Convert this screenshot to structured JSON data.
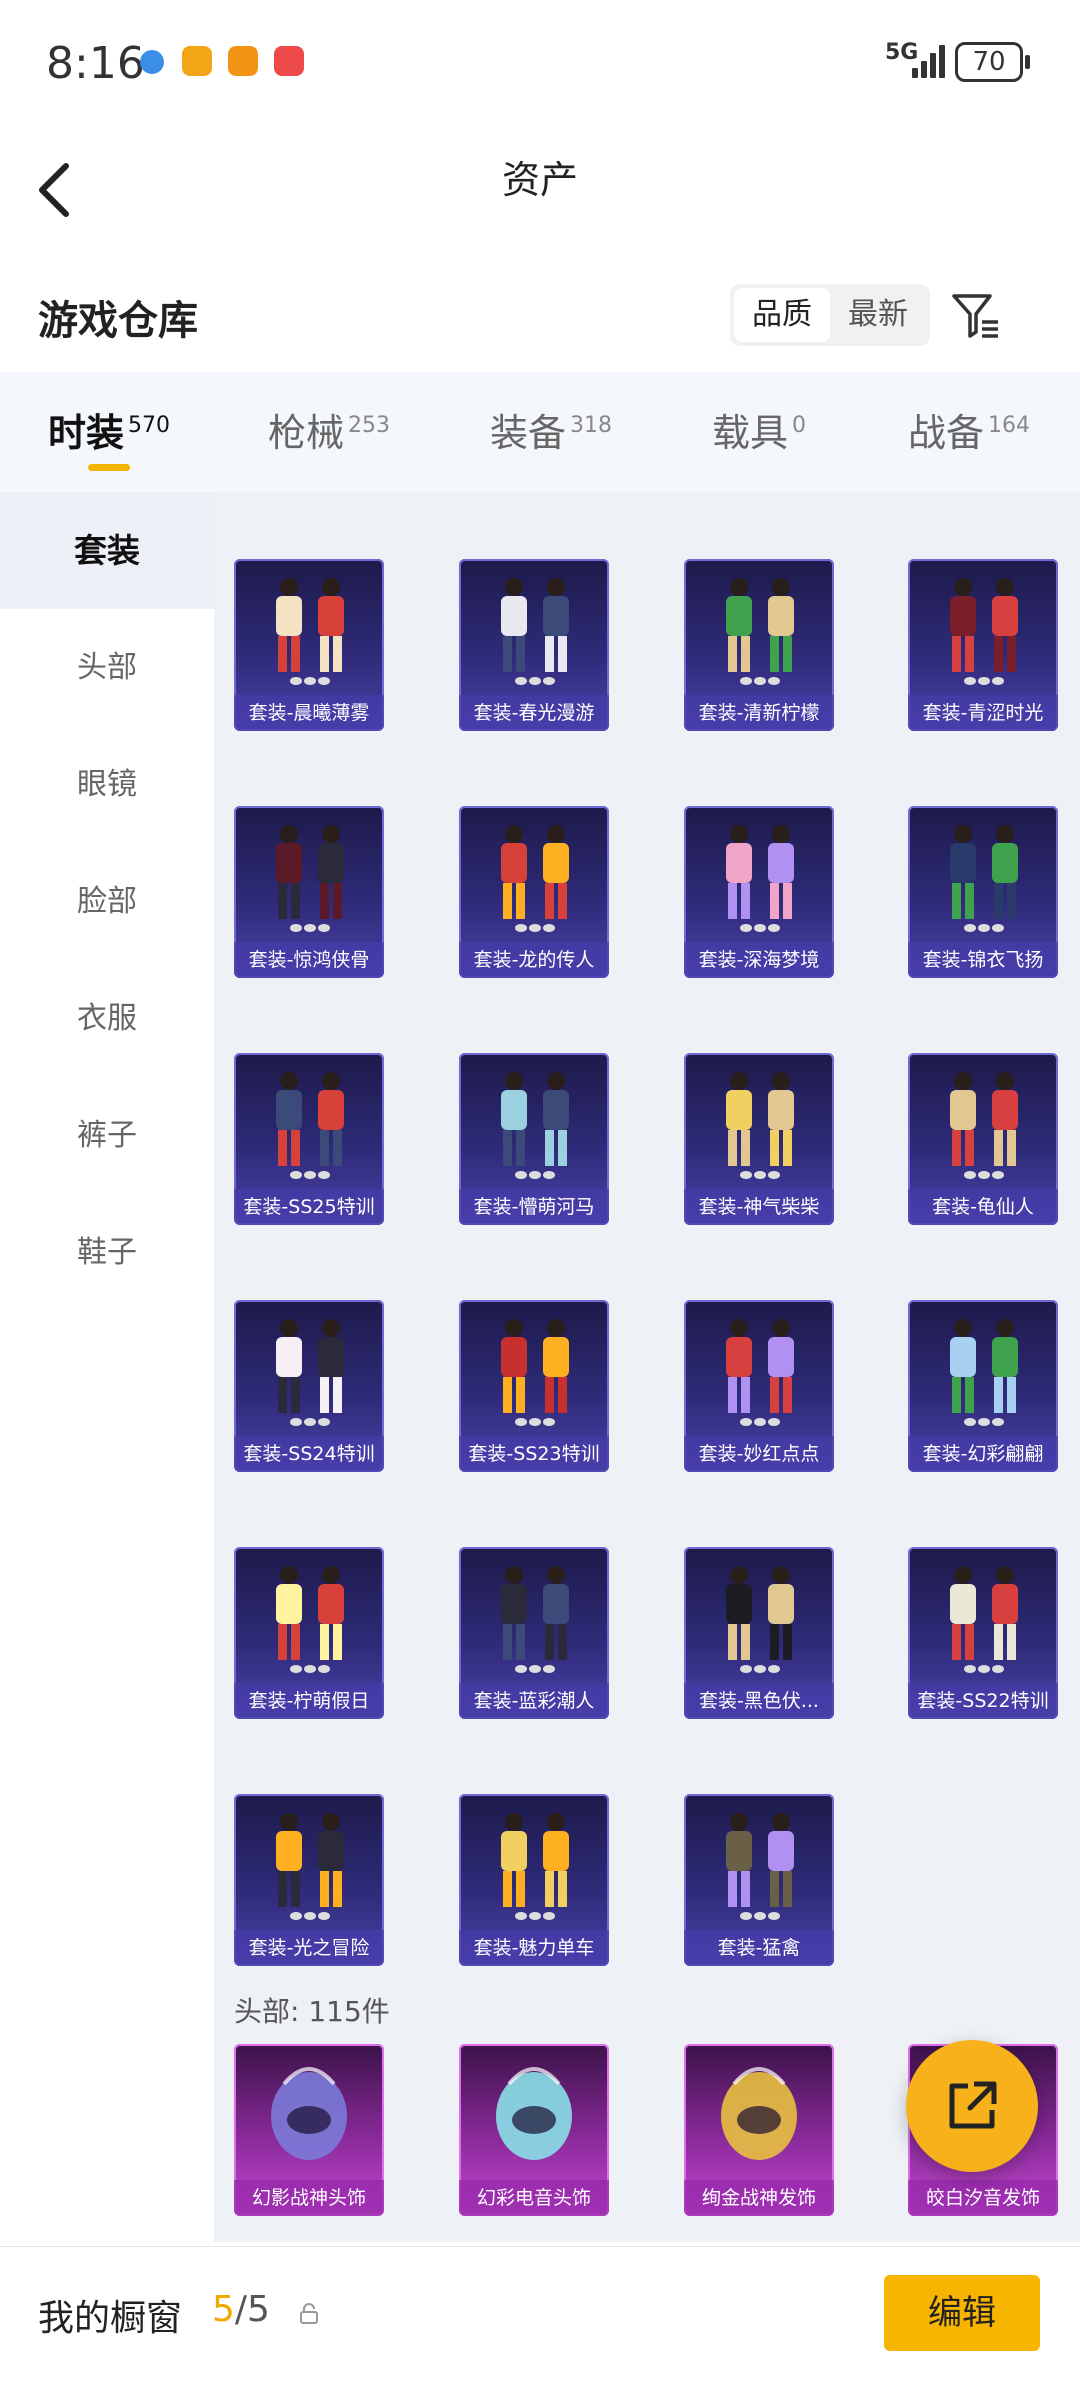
{
  "status": {
    "time": "8:16",
    "signal": "5G",
    "battery": "70"
  },
  "header": {
    "title": "资产"
  },
  "section": {
    "title": "游戏仓库"
  },
  "sort": {
    "options": [
      "品质",
      "最新"
    ]
  },
  "tabs": [
    {
      "label": "时装",
      "count": "570"
    },
    {
      "label": "枪械",
      "count": "253"
    },
    {
      "label": "装备",
      "count": "318"
    },
    {
      "label": "载具",
      "count": "0"
    },
    {
      "label": "战备",
      "count": "164"
    }
  ],
  "sidenav": [
    "套装",
    "头部",
    "眼镜",
    "脸部",
    "衣服",
    "裤子",
    "鞋子"
  ],
  "suits": [
    "套装-晨曦薄雾",
    "套装-春光漫游",
    "套装-清新柠檬",
    "套装-青涩时光",
    "套装-惊鸿侠骨",
    "套装-龙的传人",
    "套装-深海梦境",
    "套装-锦衣飞扬",
    "套装-SS25特训",
    "套装-懵萌河马",
    "套装-神气柴柴",
    "套装-龟仙人",
    "套装-SS24特训",
    "套装-SS23特训",
    "套装-妙红点点",
    "套装-幻彩翩翩",
    "套装-柠萌假日",
    "套装-蓝彩潮人",
    "套装-黑色伏...",
    "套装-SS22特训",
    "套装-光之冒险",
    "套装-魅力单车",
    "套装-猛禽"
  ],
  "head_section": {
    "title": "头部: 115件"
  },
  "heads": [
    "幻影战神头饰",
    "幻彩电音头饰",
    "绚金战神发饰",
    "皎白汐音发饰"
  ],
  "bottom": {
    "label": "我的橱窗",
    "current": "5",
    "total": "/5",
    "edit": "编辑"
  },
  "colors": {
    "accent": "#f7b500",
    "card_suit": "#2e2a78",
    "card_head": "#8a2a9a"
  }
}
